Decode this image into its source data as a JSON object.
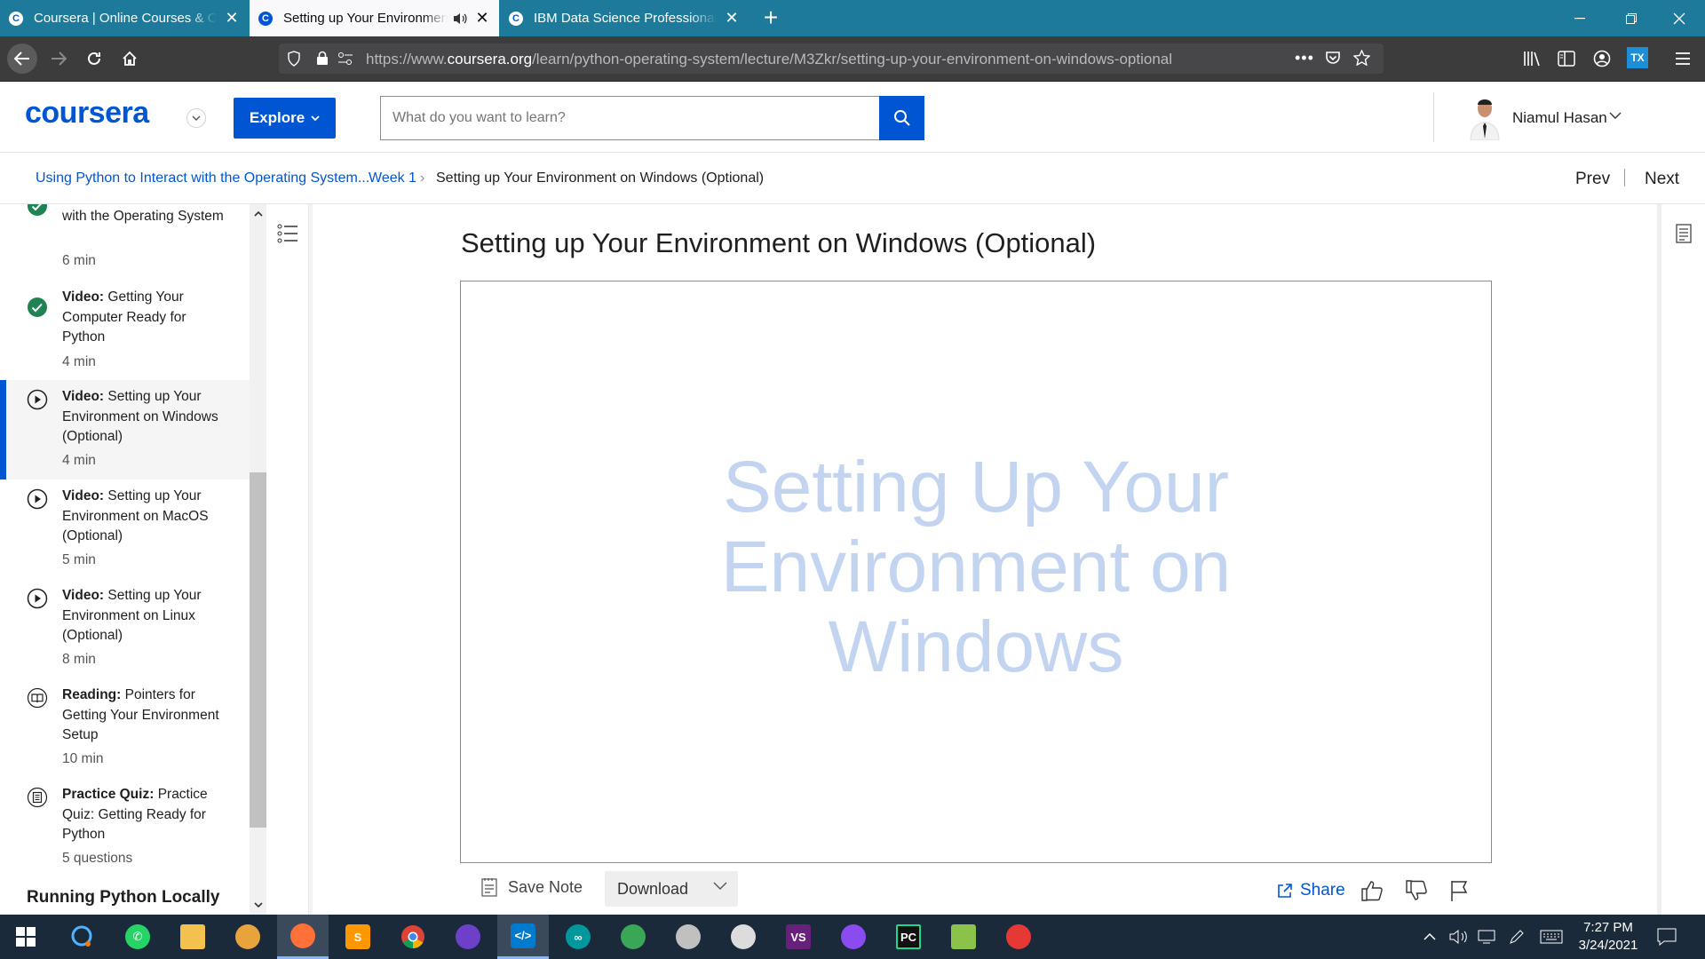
{
  "browser": {
    "tabs": [
      {
        "title": "Coursera | Online Courses & Credentials",
        "active": false
      },
      {
        "title": "Setting up Your Environment on Windows",
        "active": true
      },
      {
        "title": "IBM Data Science Professional Certificate",
        "active": false
      }
    ],
    "url_prefix": "https://www.",
    "url_domain": "coursera.org",
    "url_path": "/learn/python-operating-system/lecture/M3Zkr/setting-up-your-environment-on-windows-optional",
    "colors": {
      "tabstrip": "#1e7a9a",
      "toolbar": "#3c3c3c"
    }
  },
  "header": {
    "logo": "coursera",
    "explore_label": "Explore",
    "search_placeholder": "What do you want to learn?",
    "user_name": "Niamul Hasan",
    "brand_color": "#0056d2"
  },
  "breadcrumb": {
    "course": "Using Python to Interact with the Operating System...",
    "week": "Week 1",
    "current": "Setting up Your Environment on Windows (Optional)",
    "prev_label": "Prev",
    "next_label": "Next"
  },
  "sidebar": {
    "items": [
      {
        "kind": "",
        "title": "with the Operating System",
        "duration": "6 min",
        "status": "completed"
      },
      {
        "kind": "Video:",
        "title": "Getting Your Computer Ready for Python",
        "duration": "4 min",
        "status": "completed"
      },
      {
        "kind": "Video:",
        "title": "Setting up Your Environment on Windows (Optional)",
        "duration": "4 min",
        "status": "current"
      },
      {
        "kind": "Video:",
        "title": "Setting up Your Environment on MacOS (Optional)",
        "duration": "5 min",
        "status": "video"
      },
      {
        "kind": "Video:",
        "title": "Setting up Your Environment on Linux (Optional)",
        "duration": "8 min",
        "status": "video"
      },
      {
        "kind": "Reading:",
        "title": "Pointers for Getting Your Environment Setup",
        "duration": "10 min",
        "status": "reading"
      },
      {
        "kind": "Practice Quiz:",
        "title": "Practice Quiz: Getting Ready for Python",
        "duration": "5 questions",
        "status": "quiz"
      }
    ],
    "section_heading": "Running Python Locally"
  },
  "main": {
    "title": "Setting up Your Environment on Windows (Optional)",
    "video_slide_text": [
      "Setting Up Your",
      "Environment on",
      "Windows"
    ],
    "save_note_label": "Save Note",
    "download_label": "Download",
    "share_label": "Share"
  },
  "taskbar": {
    "apps": [
      "start-icon",
      "search-icon",
      "whatsapp-icon",
      "file-explorer-icon",
      "tor-icon",
      "firefox-icon",
      "sublime-icon",
      "chrome-icon",
      "github-icon",
      "vscode-icon",
      "arduino-icon",
      "globe-icon",
      "app-icon",
      "satellite-icon",
      "visual-studio-icon",
      "messenger-icon",
      "pycharm-icon",
      "notepad-icon",
      "game-icon"
    ],
    "time": "7:27 PM",
    "date": "3/24/2021"
  }
}
